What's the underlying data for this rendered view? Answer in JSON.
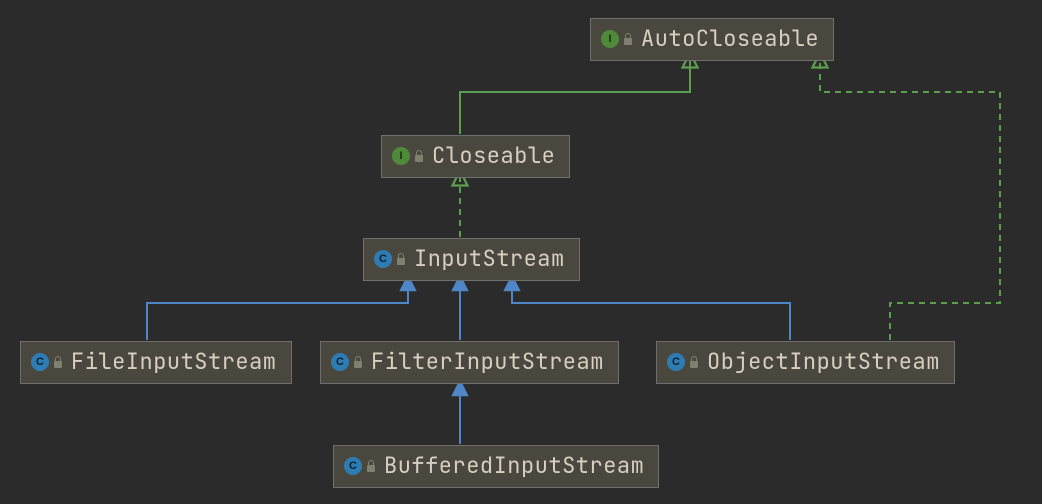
{
  "diagram": {
    "nodes": {
      "autocloseable": {
        "label": "AutoCloseable",
        "kind": "interface",
        "badge": "I"
      },
      "closeable": {
        "label": "Closeable",
        "kind": "interface",
        "badge": "I"
      },
      "inputstream": {
        "label": "InputStream",
        "kind": "abstract",
        "badge": "C"
      },
      "fileinputstream": {
        "label": "FileInputStream",
        "kind": "class",
        "badge": "C"
      },
      "filterinputstream": {
        "label": "FilterInputStream",
        "kind": "class",
        "badge": "C"
      },
      "objectinputstream": {
        "label": "ObjectInputStream",
        "kind": "class",
        "badge": "C"
      },
      "bufferedinputstream": {
        "label": "BufferedInputStream",
        "kind": "class",
        "badge": "C"
      }
    },
    "edges": [
      {
        "from": "closeable",
        "to": "autocloseable",
        "style": "solid",
        "color": "green"
      },
      {
        "from": "inputstream",
        "to": "closeable",
        "style": "dashed",
        "color": "green"
      },
      {
        "from": "fileinputstream",
        "to": "inputstream",
        "style": "solid",
        "color": "blue"
      },
      {
        "from": "filterinputstream",
        "to": "inputstream",
        "style": "solid",
        "color": "blue"
      },
      {
        "from": "objectinputstream",
        "to": "inputstream",
        "style": "solid",
        "color": "blue"
      },
      {
        "from": "objectinputstream",
        "to": "autocloseable",
        "style": "dashed",
        "color": "green"
      },
      {
        "from": "bufferedinputstream",
        "to": "filterinputstream",
        "style": "solid",
        "color": "blue"
      }
    ]
  },
  "colors": {
    "arrow_green": "#5b9e4d",
    "arrow_blue": "#4e86c7"
  }
}
